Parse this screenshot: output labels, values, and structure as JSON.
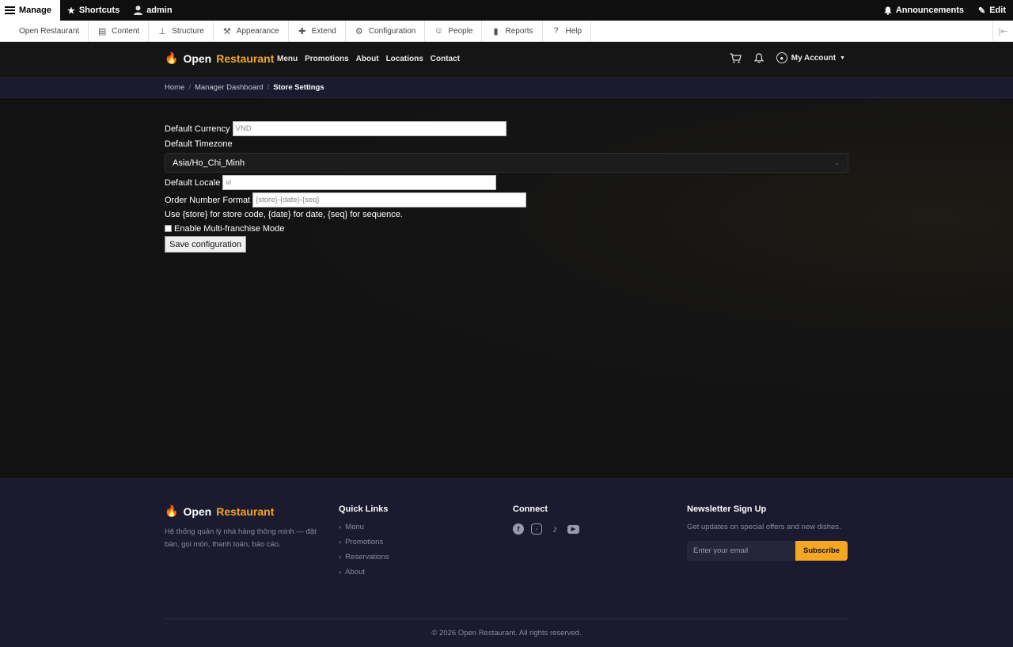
{
  "admin_toolbar": {
    "manage": "Manage",
    "shortcuts": "Shortcuts",
    "user": "admin",
    "announcements": "Announcements",
    "edit": "Edit"
  },
  "admin_tray": {
    "items": [
      "Open Restaurant",
      "Content",
      "Structure",
      "Appearance",
      "Extend",
      "Configuration",
      "People",
      "Reports",
      "Help"
    ]
  },
  "site": {
    "logo_part1": "Open",
    "logo_part2": "Restaurant",
    "nav": [
      "Menu",
      "Promotions",
      "About",
      "Locations",
      "Contact"
    ],
    "account": "My Account"
  },
  "breadcrumb": {
    "home": "Home",
    "dashboard": "Manager Dashboard",
    "current": "Store Settings",
    "separator": "/"
  },
  "form": {
    "currency_label": "Default Currency",
    "currency_value": "VND",
    "timezone_label": "Default Timezone",
    "timezone_value": "Asia/Ho_Chi_Minh",
    "locale_label": "Default Locale",
    "locale_value": "vi",
    "order_format_label": "Order Number Format",
    "order_format_value": "{store}-{date}-{seq}",
    "order_format_help": "Use {store} for store code, {date} for date, {seq} for sequence.",
    "multifranchise_label": "Enable Multi-franchise Mode",
    "multifranchise_checked": false,
    "save_label": "Save configuration"
  },
  "footer": {
    "logo_part1": "Open",
    "logo_part2": "Restaurant",
    "description": "Hệ thống quản lý nhà hàng thông minh — đặt bàn, gọi món, thanh toán, báo cáo.",
    "quick_links_title": "Quick Links",
    "quick_links": [
      "Menu",
      "Promotions",
      "Reservations",
      "About"
    ],
    "connect_title": "Connect",
    "newsletter_title": "Newsletter Sign Up",
    "newsletter_desc": "Get updates on special offers and new dishes.",
    "email_placeholder": "Enter your email",
    "subscribe_label": "Subscribe",
    "copyright": "© 2026 Open Restaurant. All rights reserved."
  },
  "colors": {
    "accent": "#f5a623",
    "header_bg": "#151515",
    "footer_bg": "#1b1a2f",
    "content_bg": "#121212"
  }
}
